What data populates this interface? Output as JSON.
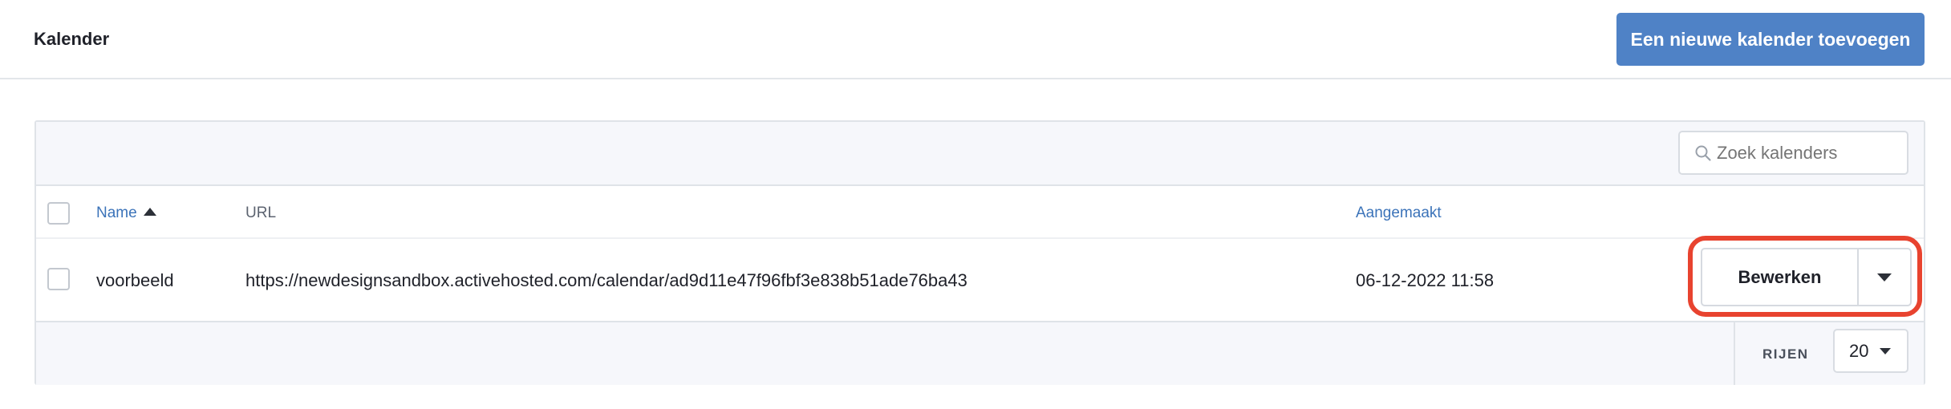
{
  "header": {
    "title": "Kalender",
    "add_button_label": "Een nieuwe kalender toevoegen"
  },
  "toolbar": {
    "search_placeholder": "Zoek kalenders",
    "search_icon": "search-icon"
  },
  "table": {
    "columns": [
      {
        "label": "Name",
        "sortable": true,
        "sort": "ascending"
      },
      {
        "label": "URL",
        "sortable": false
      },
      {
        "label": "Aangemaakt",
        "sortable": true
      }
    ],
    "rows": [
      {
        "name": "voorbeeld",
        "url": "https://newdesignsandbox.activehosted.com/calendar/ad9d11e47f96fbf3e838b51ade76ba43",
        "created": "06-12-2022 11:58",
        "action_label": "Bewerken"
      }
    ]
  },
  "footer": {
    "rows_label": "RIJEN",
    "rows_value": "20"
  },
  "colors": {
    "primary": "#4f82c6",
    "link": "#3b73b9",
    "highlight": "#e8432f"
  }
}
